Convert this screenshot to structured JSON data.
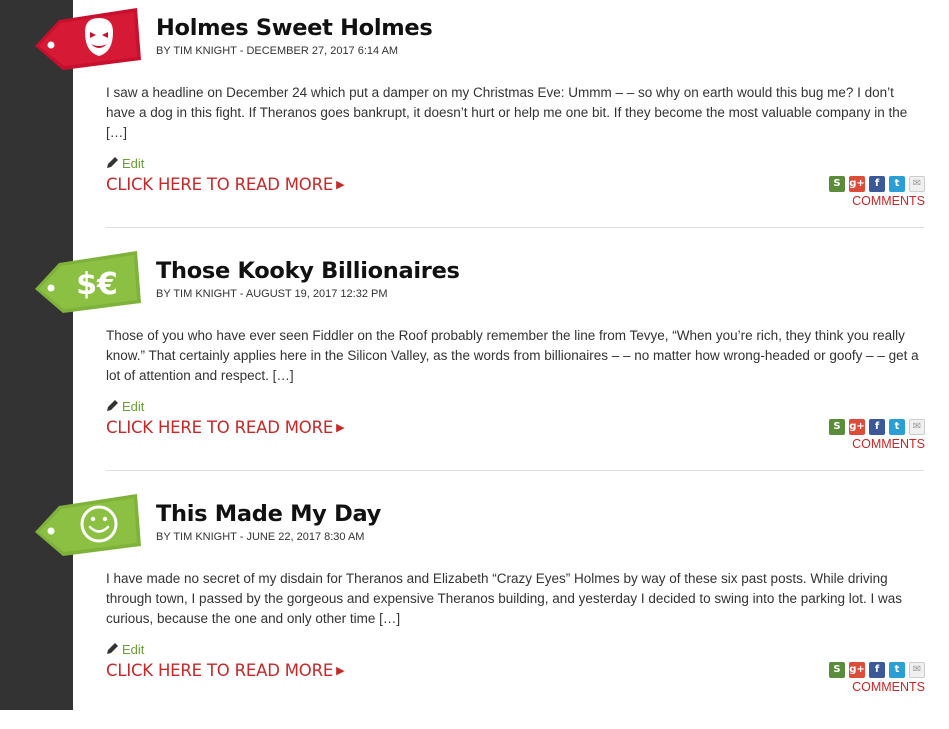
{
  "colors": {
    "sidebar": "#333333",
    "tag_red": "#c8102e",
    "tag_green": "#7fb23a",
    "link_red": "#c62828",
    "edit_green": "#6a9f32"
  },
  "posts": [
    {
      "tag_color": "red",
      "tag_icon": "mask-icon",
      "title": "Holmes Sweet Holmes",
      "byline": "BY TIM KNIGHT - DECEMBER 27, 2017 6:14 AM",
      "excerpt": "I saw a headline on December 24 which put a damper on my Christmas Eve: Ummm – – so why on earth would this bug me? I don’t have a dog in this fight. If Theranos goes bankrupt, it doesn’t hurt or help me one bit. If they become the most valuable company in the […]",
      "edit_label": "Edit",
      "read_more_label": "CLICK HERE TO READ MORE",
      "comments_label": "COMMENTS"
    },
    {
      "tag_color": "green",
      "tag_icon": "currency-icon",
      "title": "Those Kooky Billionaires",
      "byline": "BY TIM KNIGHT - AUGUST 19, 2017 12:32 PM",
      "excerpt": "Those of you who have ever seen Fiddler on the Roof probably remember the line from Tevye, “When you’re rich, they think you really know.” That certainly applies here in the Silicon Valley, as the words from billionaires – – no matter how wrong-headed or goofy – – get a lot of attention and respect. […]",
      "edit_label": "Edit",
      "read_more_label": "CLICK HERE TO READ MORE",
      "comments_label": "COMMENTS"
    },
    {
      "tag_color": "green",
      "tag_icon": "smiley-icon",
      "title": "This Made My Day",
      "byline": "BY TIM KNIGHT - JUNE 22, 2017 8:30 AM",
      "excerpt": "I have made no secret of my disdain for Theranos and Elizabeth “Crazy Eyes” Holmes by way of these six past posts. While driving through town, I passed by the gorgeous and expensive Theranos building, and  yesterday I decided to swing into the parking lot. I was curious, because the one and only other time […]",
      "edit_label": "Edit",
      "read_more_label": "CLICK HERE TO READ MORE",
      "comments_label": "COMMENTS"
    }
  ],
  "share_icons": [
    "stumbleupon-icon",
    "google-plus-icon",
    "facebook-icon",
    "twitter-icon",
    "email-icon"
  ]
}
